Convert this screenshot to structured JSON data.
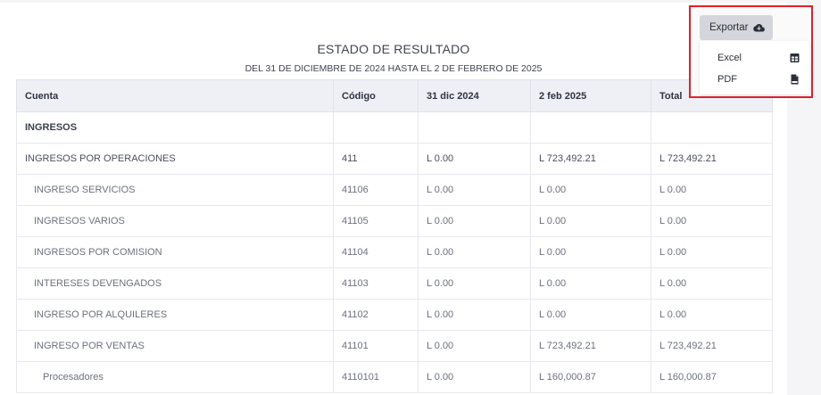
{
  "report": {
    "title": "ESTADO DE RESULTADO",
    "subtitle": "DEL 31 DE DICIEMBRE DE 2024 HASTA EL 2 DE FEBRERO DE 2025"
  },
  "table": {
    "headers": [
      "Cuenta",
      "Código",
      "31 dic 2024",
      "2 feb 2025",
      "Total"
    ],
    "rows": [
      {
        "cuenta": "INGRESOS",
        "codigo": "",
        "a": "",
        "b": "",
        "total": "",
        "level": 0
      },
      {
        "cuenta": "INGRESOS POR OPERACIONES",
        "codigo": "411",
        "a": "L 0.00",
        "b": "L 723,492.21",
        "total": "L 723,492.21",
        "level": 1
      },
      {
        "cuenta": "INGRESO SERVICIOS",
        "codigo": "41106",
        "a": "L 0.00",
        "b": "L 0.00",
        "total": "L 0.00",
        "level": 2
      },
      {
        "cuenta": "INGRESOS VARIOS",
        "codigo": "41105",
        "a": "L 0.00",
        "b": "L 0.00",
        "total": "L 0.00",
        "level": 2
      },
      {
        "cuenta": "INGRESOS POR COMISION",
        "codigo": "41104",
        "a": "L 0.00",
        "b": "L 0.00",
        "total": "L 0.00",
        "level": 2
      },
      {
        "cuenta": "INTERESES DEVENGADOS",
        "codigo": "41103",
        "a": "L 0.00",
        "b": "L 0.00",
        "total": "L 0.00",
        "level": 2
      },
      {
        "cuenta": "INGRESO POR ALQUILERES",
        "codigo": "41102",
        "a": "L 0.00",
        "b": "L 0.00",
        "total": "L 0.00",
        "level": 2
      },
      {
        "cuenta": "INGRESO POR VENTAS",
        "codigo": "41101",
        "a": "L 0.00",
        "b": "L 723,492.21",
        "total": "L 723,492.21",
        "level": 2
      },
      {
        "cuenta": "Procesadores",
        "codigo": "4110101",
        "a": "L 0.00",
        "b": "L 160,000.87",
        "total": "L 160,000.87",
        "level": 3
      }
    ]
  },
  "export": {
    "button_label": "Exportar",
    "button_icon": "cloud-download-icon",
    "menu": [
      {
        "label": "Excel",
        "icon": "table-icon"
      },
      {
        "label": "PDF",
        "icon": "pdf-file-icon"
      }
    ]
  },
  "colors": {
    "highlight_border": "#e0202a",
    "header_bg": "#eef0f6",
    "button_bg": "#d4d6db"
  }
}
